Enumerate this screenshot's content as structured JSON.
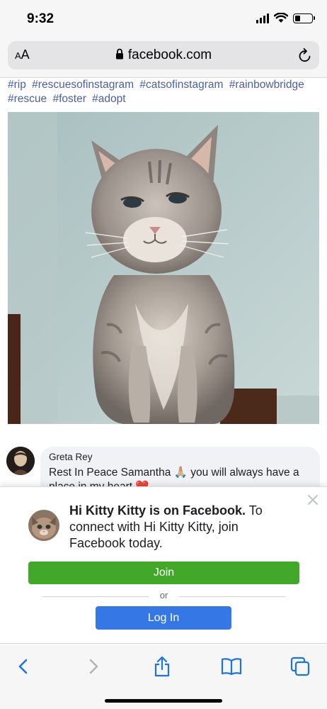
{
  "status_bar": {
    "time": "9:32"
  },
  "browser": {
    "text_size_label_small": "A",
    "text_size_label_large": "A",
    "url": "facebook.com"
  },
  "post": {
    "hashtags": [
      "#rip",
      "#rescuesofinstagram",
      "#catsofinstagram",
      "#rainbowbridge",
      "#rescue",
      "#foster",
      "#adopt"
    ],
    "photo_subject": "cat"
  },
  "comment": {
    "author": "Greta Rey",
    "text": "Rest In Peace Samantha 🙏🏼 you will always have a place in my heart ❤️"
  },
  "login_prompt": {
    "page_name": "Hi Kitty Kitty is on Facebook.",
    "message": " To connect with Hi Kitty Kitty, join Facebook today.",
    "join_label": "Join",
    "or_label": "or",
    "login_label": "Log In"
  },
  "colors": {
    "hashtag": "#4b5fa0",
    "join_button": "#42a829",
    "login_button": "#3578e5",
    "toolbar_icon": "#1a73e8"
  },
  "toolbar": {
    "icons": [
      "back-icon",
      "forward-icon",
      "share-icon",
      "bookmarks-icon",
      "tabs-icon"
    ]
  }
}
